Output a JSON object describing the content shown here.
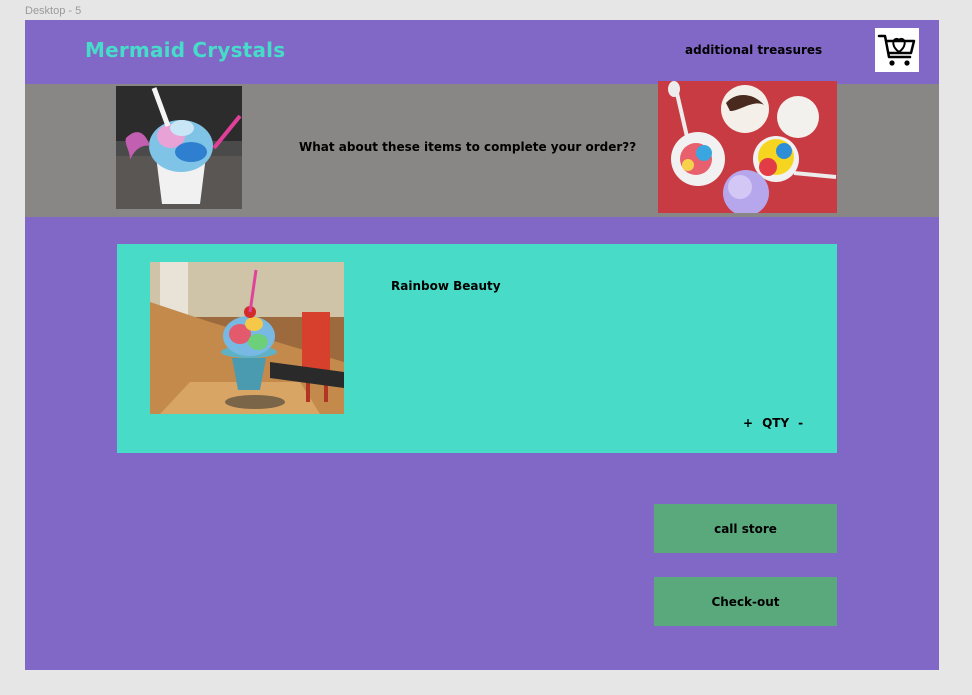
{
  "frame_label": "Desktop - 5",
  "header": {
    "brand": "Mermaid Crystals",
    "nav_link": "additional treasures",
    "cart_icon": "cart-heart-icon"
  },
  "banner": {
    "text": "What about these items to complete your order??",
    "left_image": "shaved-ice-cup-photo",
    "right_image": "assorted-shaved-ice-photo"
  },
  "item": {
    "name": "Rainbow Beauty",
    "image": "rainbow-shaved-ice-photo",
    "qty_plus": "+",
    "qty_label": "QTY",
    "qty_minus": "-"
  },
  "actions": {
    "call_store": "call store",
    "checkout": "Check-out"
  },
  "colors": {
    "frame": "#8268c6",
    "brand": "#47dbc9",
    "banner": "#888785",
    "card": "#48dcc8",
    "button": "#5aa97c"
  }
}
